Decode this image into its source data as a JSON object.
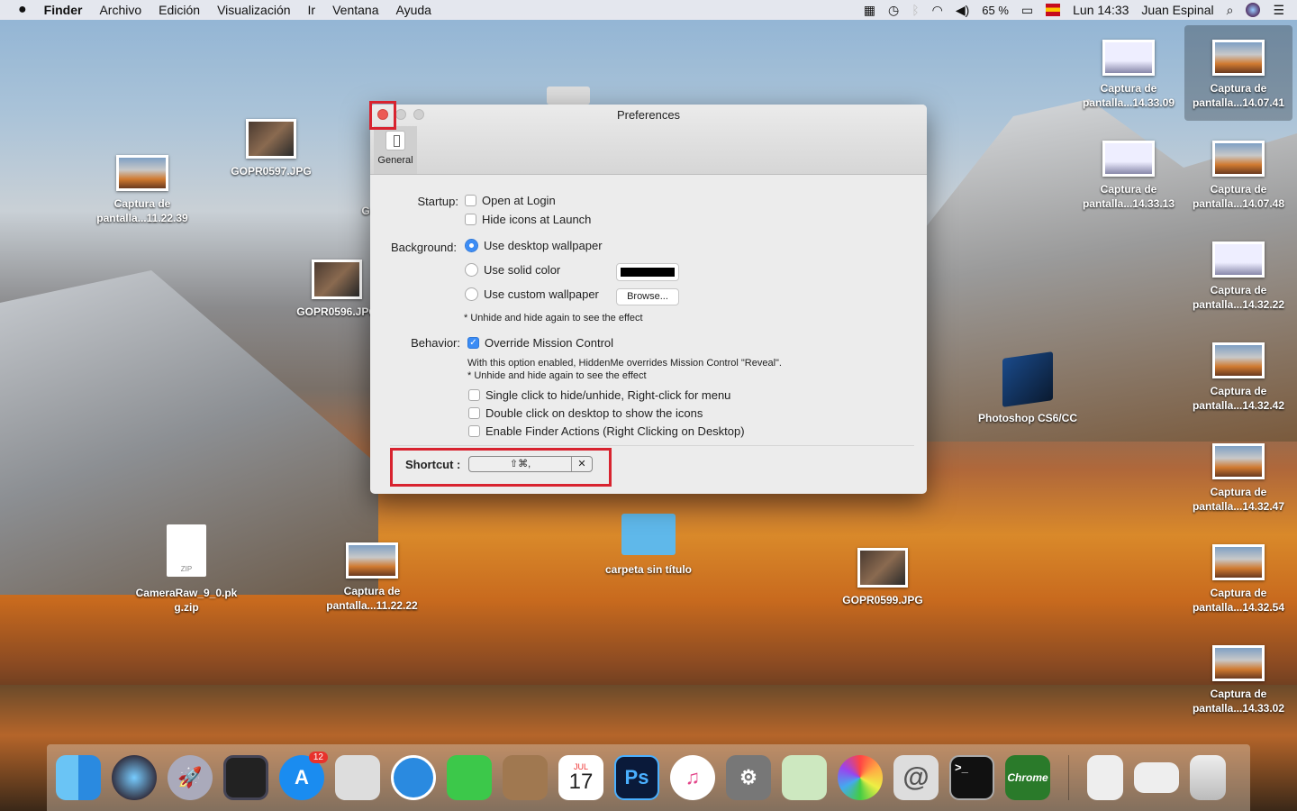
{
  "menubar": {
    "apple": "",
    "app": "Finder",
    "items": [
      "Archivo",
      "Edición",
      "Visualización",
      "Ir",
      "Ventana",
      "Ayuda"
    ],
    "battery": "65 %",
    "clock": "Lun 14:33",
    "user": "Juan Espinal"
  },
  "desktop": {
    "icons": [
      {
        "label": "Captura de pantalla...11.22.39",
        "kind": "shot"
      },
      {
        "label": "GOPR0597.JPG",
        "kind": "photo"
      },
      {
        "label": "GO",
        "kind": "photo"
      },
      {
        "label": "GOPR0596.JPG",
        "kind": "photo"
      },
      {
        "label": "CameraRaw_9_0.pkg.zip",
        "kind": "zip"
      },
      {
        "label": "Captura de pantalla...11.22.22",
        "kind": "shot"
      },
      {
        "label": "carpeta sin título",
        "kind": "folder"
      },
      {
        "label": "GOPR0599.JPG",
        "kind": "photo"
      },
      {
        "label": "Photoshop CS6/CC",
        "kind": "folder"
      },
      {
        "label": "Captura de pantalla...14.33.09",
        "kind": "shot"
      },
      {
        "label": "Captura de pantalla...14.07.41",
        "kind": "shot"
      },
      {
        "label": "Captura de pantalla...14.33.13",
        "kind": "shot"
      },
      {
        "label": "Captura de pantalla...14.07.48",
        "kind": "shot"
      },
      {
        "label": "Captura de pantalla...14.32.22",
        "kind": "shot"
      },
      {
        "label": "Captura de pantalla...14.32.42",
        "kind": "shot"
      },
      {
        "label": "Captura de pantalla...14.32.47",
        "kind": "shot"
      },
      {
        "label": "Captura de pantalla...14.32.54",
        "kind": "shot"
      },
      {
        "label": "Captura de pantalla...14.33.02",
        "kind": "shot"
      }
    ],
    "zip_ext": "ZIP"
  },
  "prefs": {
    "title": "Preferences",
    "tab": "General",
    "startup_label": "Startup:",
    "open_login": "Open at Login",
    "hide_launch": "Hide icons at Launch",
    "background_label": "Background:",
    "bg_wallpaper": "Use desktop wallpaper",
    "bg_solid": "Use solid color",
    "bg_custom": "Use custom wallpaper",
    "browse": "Browse...",
    "note1": "* Unhide and hide again to see the effect",
    "solid_color": "#000000",
    "behavior_label": "Behavior:",
    "override": "Override Mission Control",
    "override_desc": "With this option enabled, HiddenMe overrides Mission Control \"Reveal\".",
    "note2": "* Unhide and hide again to see the effect",
    "single_click": "Single click to hide/unhide, Right-click for menu",
    "double_click": "Double click on desktop to show the icons",
    "finder_actions": "Enable Finder Actions (Right Clicking on Desktop)",
    "shortcut_label": "Shortcut :",
    "shortcut_value": "⇧⌘,",
    "clear": "✕",
    "highlight_color": "#d8232f"
  },
  "dock": {
    "app_store_badge": "12",
    "calendar_month": "JUL",
    "calendar_day": "17",
    "ps": "Ps",
    "mail": "@",
    "terminal": ">_",
    "chrome": "Chrome"
  }
}
